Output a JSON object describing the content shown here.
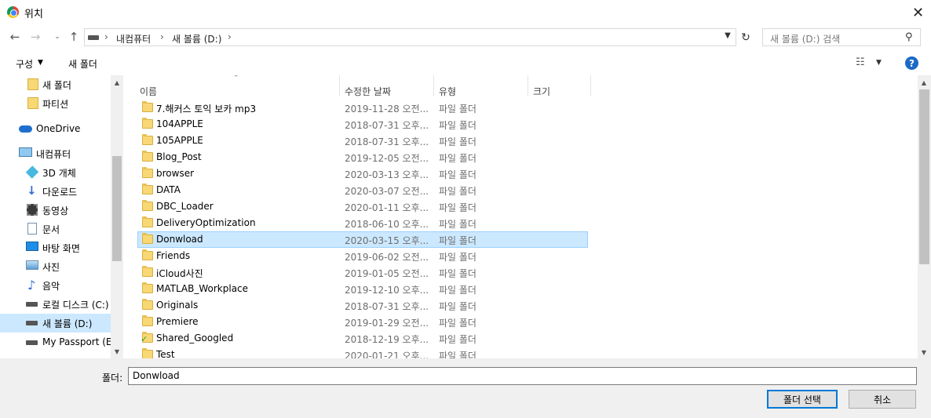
{
  "window": {
    "title": "위치"
  },
  "address": {
    "crumbs": [
      "내컴퓨터",
      "새 볼륨 (D:)"
    ],
    "sep": "›"
  },
  "search": {
    "placeholder": "새 볼륨 (D:) 검색"
  },
  "toolbar": {
    "organize_label": "구성",
    "new_folder_label": "새 폴더"
  },
  "nav": {
    "items": [
      {
        "label": "새 폴더",
        "icon": "folder-icon"
      },
      {
        "label": "파티션",
        "icon": "folder-icon"
      },
      {
        "label": "OneDrive",
        "icon": "onedrive-icon"
      },
      {
        "label": "내컴퓨터",
        "icon": "computer-icon"
      },
      {
        "label": "3D 개체",
        "icon": "3d-objects-icon"
      },
      {
        "label": "다운로드",
        "icon": "download-icon"
      },
      {
        "label": "동영상",
        "icon": "video-icon"
      },
      {
        "label": "문서",
        "icon": "document-icon"
      },
      {
        "label": "바탕 화면",
        "icon": "desktop-icon"
      },
      {
        "label": "사진",
        "icon": "pictures-icon"
      },
      {
        "label": "음악",
        "icon": "music-icon"
      },
      {
        "label": "로컬 디스크 (C:)",
        "icon": "drive-icon"
      },
      {
        "label": "새 볼륨 (D:)",
        "icon": "drive-icon"
      },
      {
        "label": "My Passport (E:)",
        "icon": "drive-icon"
      }
    ]
  },
  "columns": {
    "name": "이름",
    "date": "수정한 날짜",
    "type": "유형",
    "size": "크기"
  },
  "files": [
    {
      "name": "7.해커스 토익 보카 mp3",
      "date": "2019-11-28 오전...",
      "type": "파일 폴더"
    },
    {
      "name": "104APPLE",
      "date": "2018-07-31 오후...",
      "type": "파일 폴더"
    },
    {
      "name": "105APPLE",
      "date": "2018-07-31 오후...",
      "type": "파일 폴더"
    },
    {
      "name": "Blog_Post",
      "date": "2019-12-05 오전...",
      "type": "파일 폴더"
    },
    {
      "name": "browser",
      "date": "2020-03-13 오후...",
      "type": "파일 폴더"
    },
    {
      "name": "DATA",
      "date": "2020-03-07 오전...",
      "type": "파일 폴더"
    },
    {
      "name": "DBC_Loader",
      "date": "2020-01-11 오후...",
      "type": "파일 폴더"
    },
    {
      "name": "DeliveryOptimization",
      "date": "2018-06-10 오후...",
      "type": "파일 폴더"
    },
    {
      "name": "Donwload",
      "date": "2020-03-15 오후...",
      "type": "파일 폴더"
    },
    {
      "name": "Friends",
      "date": "2019-06-02 오전...",
      "type": "파일 폴더"
    },
    {
      "name": "iCloud사진",
      "date": "2019-01-05 오전...",
      "type": "파일 폴더"
    },
    {
      "name": "MATLAB_Workplace",
      "date": "2019-12-10 오후...",
      "type": "파일 폴더"
    },
    {
      "name": "Originals",
      "date": "2018-07-31 오후...",
      "type": "파일 폴더"
    },
    {
      "name": "Premiere",
      "date": "2019-01-29 오전...",
      "type": "파일 폴더"
    },
    {
      "name": "Shared_Googled",
      "date": "2018-12-19 오후...",
      "type": "파일 폴더"
    },
    {
      "name": "Test",
      "date": "2020-01-21 오후...",
      "type": "파일 폴더"
    }
  ],
  "footer": {
    "folder_label": "폴더:",
    "folder_value": "Donwload",
    "select_label": "폴더 선택",
    "cancel_label": "취소"
  },
  "colors": {
    "selection": "#cce8ff",
    "selection_border": "#99d1ff",
    "accent": "#0078d7"
  }
}
